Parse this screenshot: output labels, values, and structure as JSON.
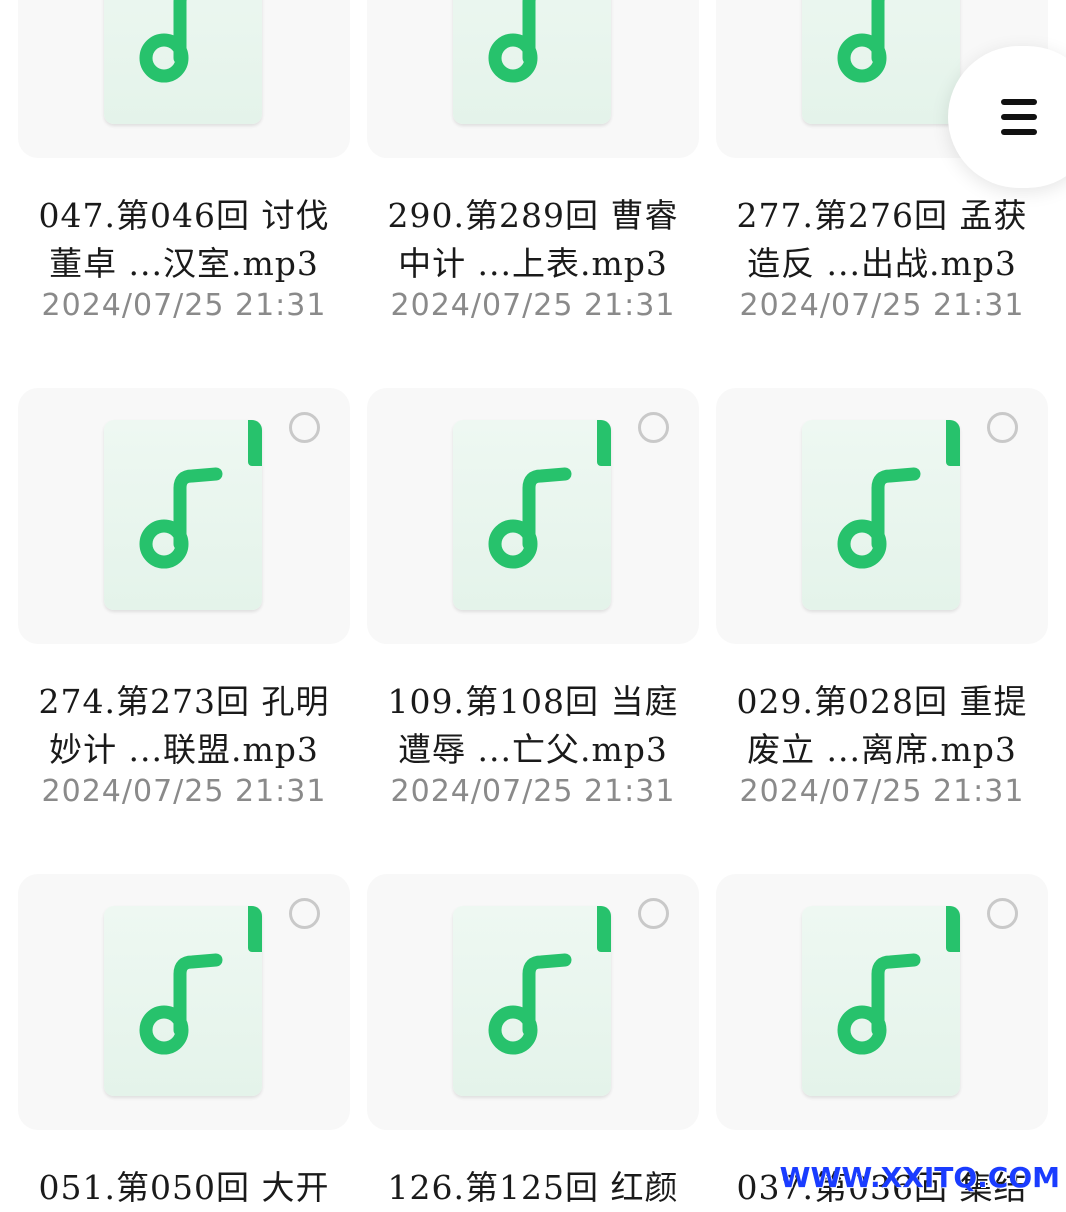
{
  "file_icon": "music-file-icon",
  "accent_color": "#27c26c",
  "files": [
    {
      "name_line1": "047.第046回 讨伐",
      "name_line2": "董卓 ...汉室.mp3",
      "date": "2024/07/25 21:31"
    },
    {
      "name_line1": "290.第289回 曹睿",
      "name_line2": "中计 ...上表.mp3",
      "date": "2024/07/25 21:31"
    },
    {
      "name_line1": "277.第276回 孟获",
      "name_line2": "造反 ...出战.mp3",
      "date": "2024/07/25 21:31"
    },
    {
      "name_line1": "274.第273回 孔明",
      "name_line2": "妙计 ...联盟.mp3",
      "date": "2024/07/25 21:31"
    },
    {
      "name_line1": "109.第108回 当庭",
      "name_line2": "遭辱 ...亡父.mp3",
      "date": "2024/07/25 21:31"
    },
    {
      "name_line1": "029.第028回 重提",
      "name_line2": "废立 ...离席.mp3",
      "date": "2024/07/25 21:31"
    },
    {
      "name_line1": "051.第050回 大开",
      "name_line2": "",
      "date": ""
    },
    {
      "name_line1": "126.第125回 红颜",
      "name_line2": "",
      "date": ""
    },
    {
      "name_line1": "037.第036回 集结",
      "name_line2": "",
      "date": ""
    }
  ],
  "menu_button": {
    "icon": "menu-icon"
  },
  "watermark": "WWW.XXITQ.COM"
}
